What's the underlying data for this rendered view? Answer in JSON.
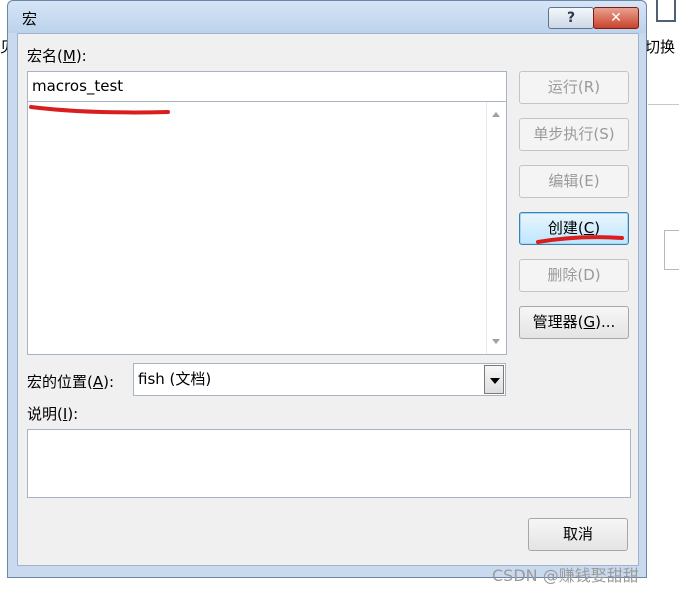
{
  "background": {
    "left_fragment": "见",
    "right_fragment": "切换"
  },
  "dialog": {
    "title": "宏",
    "help_label": "?",
    "close_label": "✕",
    "macro_name_label": "宏名",
    "macro_name_access": "M",
    "macro_name_value": "macros_test",
    "location_label": "宏的位置",
    "location_access": "A",
    "location_value": "fish (文档)",
    "description_label": "说明",
    "description_access": "I",
    "description_value": ""
  },
  "buttons": {
    "run": "运行(R)",
    "step": "单步执行(S)",
    "edit": "编辑(E)",
    "create_pre": "创建(",
    "create_key": "C",
    "create_post": ")",
    "delete": "删除(D)",
    "organizer_pre": "管理器(",
    "organizer_key": "G",
    "organizer_post": ")...",
    "cancel": "取消"
  },
  "annotations": {
    "color": "#d81e1e"
  },
  "watermark": "CSDN @赚钱娶甜甜"
}
